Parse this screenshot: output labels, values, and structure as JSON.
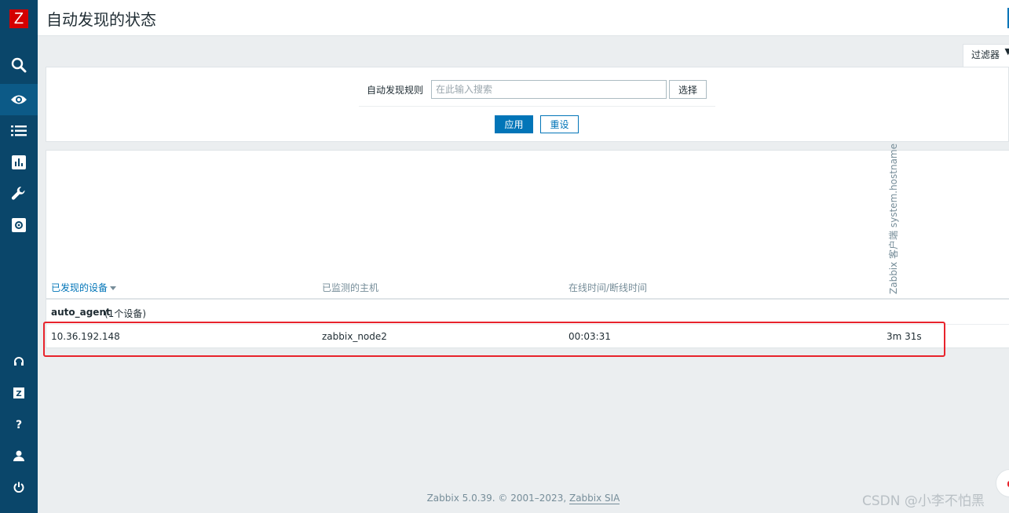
{
  "app": {
    "logo_letter": "Z",
    "page_title": "自动发现的状态"
  },
  "sidebar": {
    "items": [
      {
        "name": "search-icon"
      },
      {
        "name": "eye-icon",
        "active": true
      },
      {
        "name": "list-icon"
      },
      {
        "name": "chart-icon"
      },
      {
        "name": "wrench-icon"
      },
      {
        "name": "gear-icon"
      },
      {
        "name": "support-icon"
      },
      {
        "name": "share-icon",
        "label": "Z"
      },
      {
        "name": "help-icon",
        "label": "?"
      },
      {
        "name": "user-icon"
      },
      {
        "name": "power-icon"
      }
    ]
  },
  "filter": {
    "tab_label": "过滤器",
    "rule_label": "自动发现规则",
    "rule_placeholder": "在此输入搜索",
    "select_label": "选择",
    "apply_label": "应用",
    "reset_label": "重设"
  },
  "table": {
    "columns": {
      "discovered_device": "已发现的设备",
      "monitored_host": "已监测的主机",
      "uptime_downtime": "在线时间/断线时间",
      "check": "Zabbix 客户端  system.hostname"
    },
    "groups": [
      {
        "name": "auto_agent",
        "count_label": "(1个设备)",
        "rows": [
          {
            "device": "10.36.192.148",
            "host": "zabbix_node2",
            "uptime": "00:03:31",
            "check_value": "3m 31s"
          }
        ]
      }
    ]
  },
  "footer": {
    "text": "Zabbix 5.0.39. © 2001–2023, ",
    "link": "Zabbix SIA"
  },
  "watermark": "CSDN @小李不怕黑",
  "colors": {
    "sidebar": "#0a466a",
    "accent": "#0275b8",
    "highlight": "#e8232c",
    "logo": "#d40000"
  }
}
